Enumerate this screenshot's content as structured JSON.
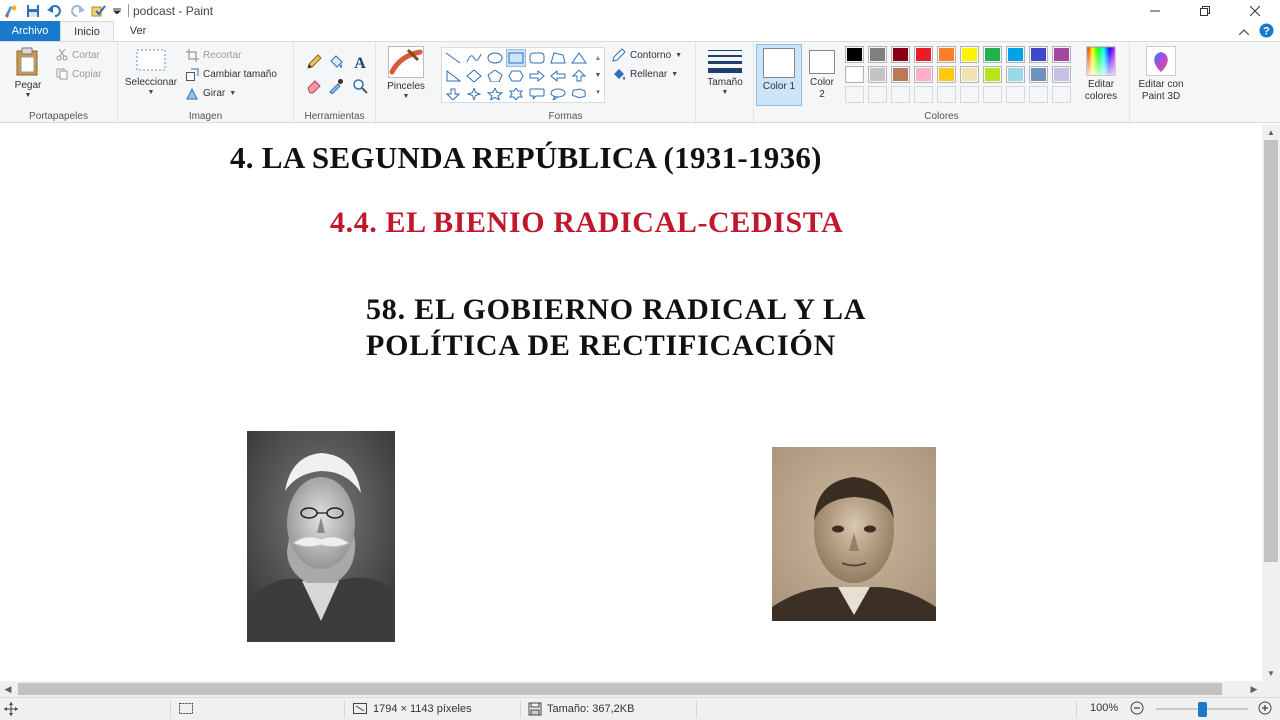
{
  "window": {
    "title": "podcast - Paint"
  },
  "tabs": {
    "file": "Archivo",
    "home": "Inicio",
    "view": "Ver"
  },
  "ribbon": {
    "clipboard": {
      "label": "Portapapeles",
      "paste": "Pegar",
      "cut": "Cortar",
      "copy": "Copiar"
    },
    "image": {
      "label": "Imagen",
      "select": "Seleccionar",
      "crop": "Recortar",
      "resize": "Cambiar tamaño",
      "rotate": "Girar"
    },
    "tools": {
      "label": "Herramientas"
    },
    "brushes": {
      "label": "Pinceles"
    },
    "shapes": {
      "label": "Formas",
      "outline": "Contorno",
      "fill": "Rellenar"
    },
    "size": {
      "label": "Tamaño"
    },
    "colors": {
      "label": "Colores",
      "color1": "Color 1",
      "color2": "Color 2",
      "edit_colors": "Editar colores",
      "paint3d": "Editar con Paint 3D",
      "palette_row1": [
        "#000000",
        "#7f7f7f",
        "#880015",
        "#ed1c24",
        "#ff7f27",
        "#fff200",
        "#22b14c",
        "#00a2e8",
        "#3f48cc",
        "#a349a4"
      ],
      "palette_row2": [
        "#ffffff",
        "#c3c3c3",
        "#b97a57",
        "#ffaec9",
        "#ffc90e",
        "#efe4b0",
        "#b5e61d",
        "#99d9ea",
        "#7092be",
        "#c8bfe7"
      ]
    }
  },
  "document": {
    "line1": "4. LA SEGUNDA REPÚBLICA (1931-1936)",
    "line2": "4.4. EL BIENIO RADICAL-CEDISTA",
    "line3": "58. EL GOBIERNO RADICAL Y LA",
    "line4": "POLÍTICA DE RECTIFICACIÓN"
  },
  "statusbar": {
    "dimensions": "1794 × 1143 píxeles",
    "filesize": "Tamaño: 367,2KB",
    "zoom": "100%",
    "zoom_level_percent": 100
  }
}
